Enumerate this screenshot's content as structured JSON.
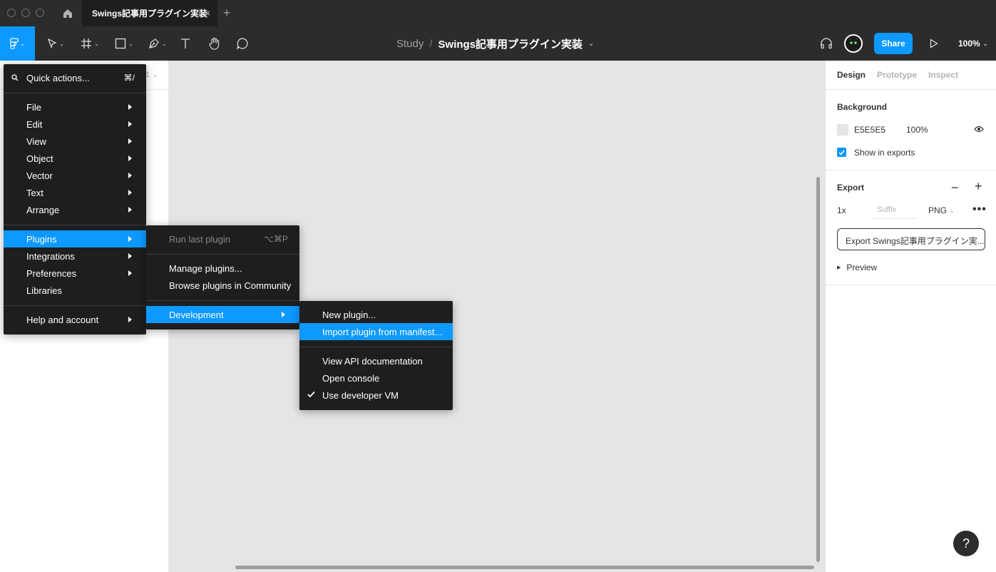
{
  "window": {
    "tab_title": "Swings記事用プラグイン実装",
    "tab_close": "×",
    "tab_add": "+"
  },
  "toolbar": {
    "breadcrumb_project": "Study",
    "breadcrumb_separator": "/",
    "breadcrumb_file": "Swings記事用プラグイン実装",
    "share_label": "Share",
    "zoom_label": "100%"
  },
  "left_panel": {
    "page_fragment": "1"
  },
  "main_menu": {
    "search_label": "Quick actions...",
    "search_shortcut": "⌘/",
    "items": [
      {
        "label": "File"
      },
      {
        "label": "Edit"
      },
      {
        "label": "View"
      },
      {
        "label": "Object"
      },
      {
        "label": "Vector"
      },
      {
        "label": "Text"
      },
      {
        "label": "Arrange"
      },
      {
        "label": "Plugins"
      },
      {
        "label": "Integrations"
      },
      {
        "label": "Preferences"
      },
      {
        "label": "Libraries"
      },
      {
        "label": "Help and account"
      }
    ]
  },
  "plugins_menu": {
    "items": [
      {
        "label": "Run last plugin",
        "shortcut": "⌥⌘P"
      },
      {
        "label": "Manage plugins..."
      },
      {
        "label": "Browse plugins in Community"
      },
      {
        "label": "Development"
      }
    ]
  },
  "development_menu": {
    "items": [
      {
        "label": "New plugin..."
      },
      {
        "label": "Import plugin from manifest..."
      },
      {
        "label": "View API documentation"
      },
      {
        "label": "Open console"
      },
      {
        "label": "Use developer VM",
        "checked": true
      }
    ]
  },
  "right_panel": {
    "tabs": [
      "Design",
      "Prototype",
      "Inspect"
    ],
    "background_title": "Background",
    "background_hex": "E5E5E5",
    "background_opacity": "100%",
    "show_in_exports": "Show in exports",
    "export_title": "Export",
    "export_minus": "−",
    "export_plus": "+",
    "export_scale": "1x",
    "suffix_placeholder": "Suffix",
    "export_format": "PNG",
    "more": "•••",
    "export_button": "Export Swings記事用プラグイン実...",
    "preview_label": "Preview",
    "help": "?"
  },
  "colors": {
    "accent": "#0d99ff",
    "toolbar_bg": "#2c2c2c",
    "menu_bg": "#1e1e1e",
    "canvas_bg": "#e5e5e5"
  },
  "icons": [
    "home-icon",
    "figma-logo-icon",
    "move-tool-icon",
    "frame-tool-icon",
    "shape-tool-icon",
    "pen-tool-icon",
    "text-tool-icon",
    "hand-tool-icon",
    "comment-tool-icon",
    "headphones-icon",
    "play-icon",
    "search-icon",
    "eye-icon",
    "check-icon"
  ]
}
